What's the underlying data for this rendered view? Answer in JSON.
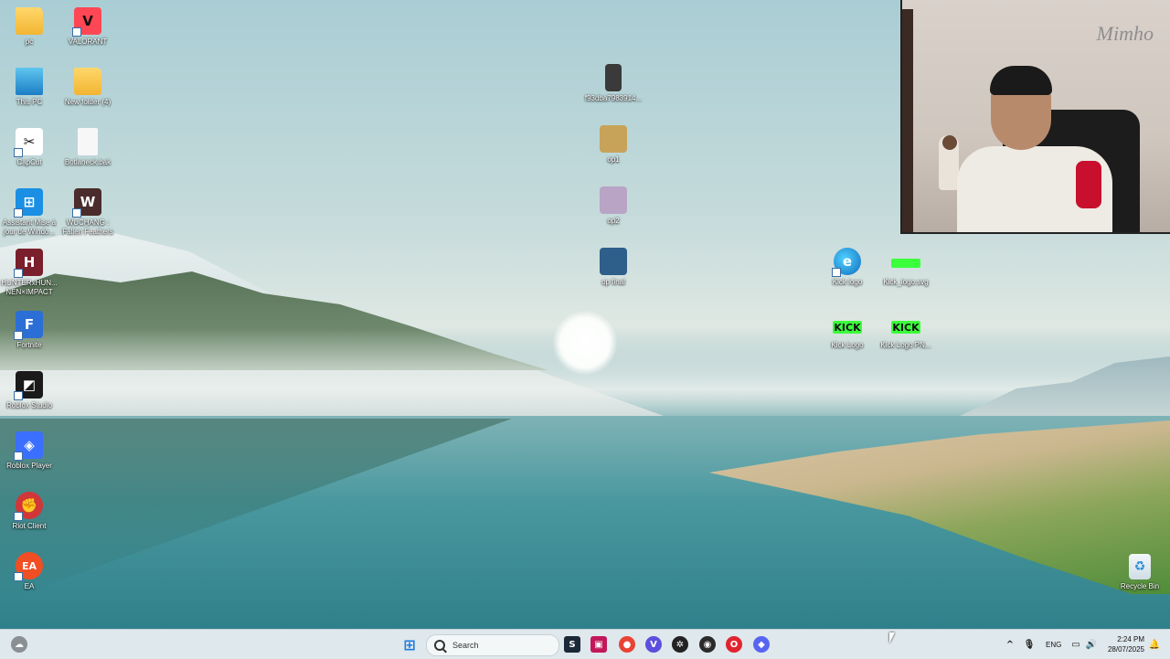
{
  "desktop": {
    "icons_left": [
      {
        "name": "pc-folder",
        "label": "pc",
        "kind": "folder"
      },
      {
        "name": "valorant",
        "label": "VALORANT",
        "kind": "app",
        "color": "#ff4655"
      },
      {
        "name": "this-pc",
        "label": "This PC",
        "kind": "thispc"
      },
      {
        "name": "new-folder-4",
        "label": "New folder (4)",
        "kind": "folder"
      },
      {
        "name": "capcut",
        "label": "CapCut",
        "kind": "app",
        "color": "#111111"
      },
      {
        "name": "bottleneck-file",
        "label": "Botlaneck.bak",
        "kind": "doc"
      },
      {
        "name": "assistant-windows",
        "label": "Assistant Mise à jour de Windo...",
        "kind": "app",
        "color": "#1a8fe3"
      },
      {
        "name": "wuchang",
        "label": "WUCHANG : Fallen Feathers",
        "kind": "app",
        "color": "#4a2c2c"
      },
      {
        "name": "hunter-hunter",
        "label": "HUNTERxHUN... NEN×IMPACT",
        "kind": "app",
        "color": "#7a1f2b"
      },
      {
        "name": "fortnite",
        "label": "Fortnite",
        "kind": "app",
        "color": "#2b6fd6"
      },
      {
        "name": "roblox-studio",
        "label": "Roblox Studio",
        "kind": "app",
        "color": "#1a1a1a"
      },
      {
        "name": "roblox-player",
        "label": "Roblox Player",
        "kind": "app",
        "color": "#3b6fff"
      },
      {
        "name": "riot-client",
        "label": "Riot Client",
        "kind": "app",
        "color": "#d13639"
      },
      {
        "name": "ea",
        "label": "EA",
        "kind": "app",
        "color": "#f04e23"
      }
    ],
    "icons_middle": [
      {
        "name": "image-file",
        "label": "f93dba7983914...",
        "color": "#3a3a3a"
      },
      {
        "name": "op1",
        "label": "op1",
        "color": "#c7a35a"
      },
      {
        "name": "op2",
        "label": "op2",
        "color": "#b9a4c6"
      },
      {
        "name": "op-final",
        "label": "op final",
        "color": "#2e5f8a"
      }
    ],
    "icons_right": [
      {
        "name": "kick-logo-edge",
        "label": "Kick logo",
        "kind": "edge"
      },
      {
        "name": "kick-logo-jpg",
        "label": "Kick_logo.svg",
        "kind": "kickbar"
      },
      {
        "name": "kick-logo-2",
        "label": "Kick Logo",
        "kind": "kick",
        "text": "KICK"
      },
      {
        "name": "kick-logo-png",
        "label": "Kick Logo PN...",
        "kind": "kick",
        "text": "KICK"
      }
    ],
    "recycle_bin": {
      "label": "Recycle Bin"
    }
  },
  "webcam": {
    "watermark": "Mimho"
  },
  "taskbar": {
    "search_placeholder": "Search",
    "apps": [
      {
        "name": "start",
        "glyph": "⊞",
        "color": "#1f7ae0"
      },
      {
        "name": "steam",
        "glyph": "S",
        "color": "#1b2838"
      },
      {
        "name": "app-generic",
        "glyph": "▣",
        "color": "#c2185b"
      },
      {
        "name": "chrome",
        "glyph": "●",
        "color": "#e94335"
      },
      {
        "name": "v-app",
        "glyph": "V",
        "color": "#5b4fe0"
      },
      {
        "name": "chatgpt",
        "glyph": "✲",
        "color": "#222222"
      },
      {
        "name": "obs",
        "glyph": "◉",
        "color": "#2a2a2a"
      },
      {
        "name": "opera",
        "glyph": "O",
        "color": "#e0242f"
      },
      {
        "name": "discord",
        "glyph": "◆",
        "color": "#5865f2"
      }
    ],
    "tray": {
      "language": "ENG",
      "time": "2:24 PM",
      "date": "28/07/2025"
    }
  }
}
